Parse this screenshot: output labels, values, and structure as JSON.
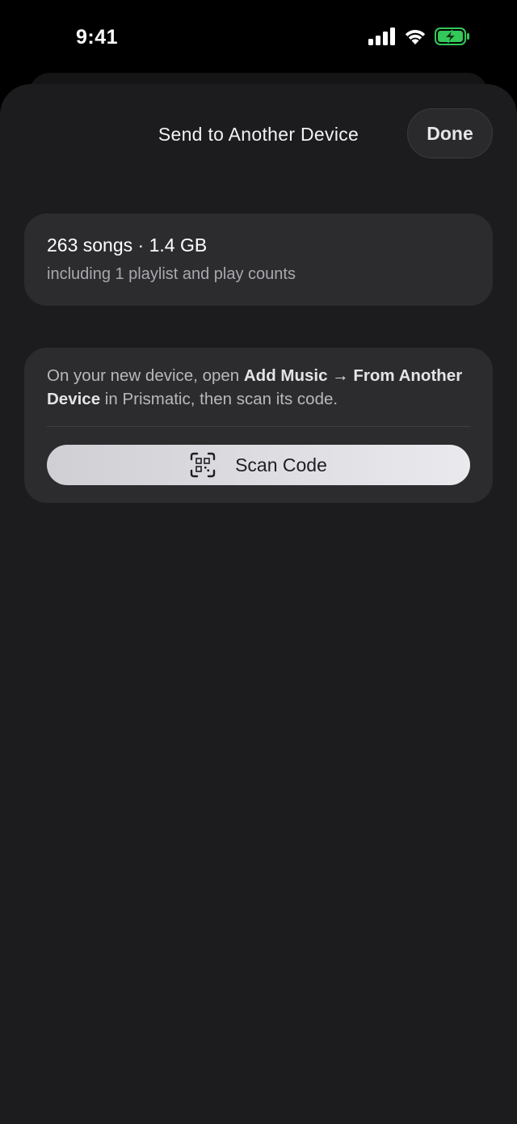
{
  "status_bar": {
    "time": "9:41",
    "icons": [
      "cellular-signal-icon",
      "wifi-icon",
      "battery-charging-icon"
    ],
    "battery_color": "#34c759"
  },
  "sheet": {
    "title": "Send to Another Device",
    "done_label": "Done"
  },
  "summary": {
    "title": "263 songs · 1.4 GB",
    "subtitle": "including 1 playlist and play counts"
  },
  "instructions": {
    "text_1": "On your new device, open ",
    "bold_1": "Add Music → From Another Device",
    "text_2": " in Prismatic, then scan its code.",
    "button_label": "Scan Code",
    "button_icon": "qr-code-scan-icon"
  },
  "colors": {
    "background": "#1c1c1e",
    "card": "#2c2c2e",
    "accent_button": "#e9e9ee"
  }
}
